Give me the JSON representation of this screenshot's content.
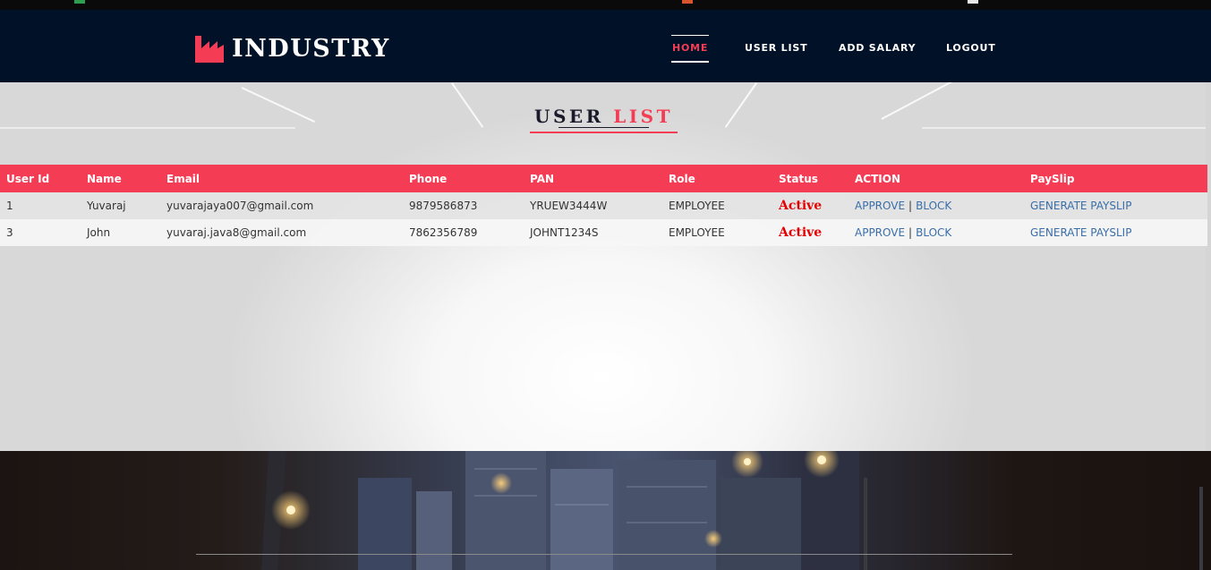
{
  "brand": {
    "name": "INDUSTRY",
    "icon": "factory-icon",
    "accent_color": "#f43d55"
  },
  "nav": {
    "items": [
      {
        "label": "HOME",
        "active": true
      },
      {
        "label": "USER LIST",
        "active": false
      },
      {
        "label": "ADD SALARY",
        "active": false
      },
      {
        "label": "LOGOUT",
        "active": false
      }
    ]
  },
  "page": {
    "title_part1": "USER",
    "title_part2": "LIST"
  },
  "table": {
    "headers": [
      "User Id",
      "Name",
      "Email",
      "Phone",
      "PAN",
      "Role",
      "Status",
      "ACTION",
      "PaySlip"
    ],
    "rows": [
      {
        "id": "1",
        "name": "Yuvaraj",
        "email": "yuvarajaya007@gmail.com",
        "phone": "9879586873",
        "pan": "YRUEW3444W",
        "role": "EMPLOYEE",
        "status": "Active",
        "approve": "APPROVE",
        "separator": "|",
        "block": "BLOCK",
        "payslip": "GENERATE PAYSLIP"
      },
      {
        "id": "3",
        "name": "John",
        "email": "yuvaraj.java8@gmail.com",
        "phone": "7862356789",
        "pan": "JOHNT1234S",
        "role": "EMPLOYEE",
        "status": "Active",
        "approve": "APPROVE",
        "separator": "|",
        "block": "BLOCK",
        "payslip": "GENERATE PAYSLIP"
      }
    ]
  },
  "colors": {
    "navbar_bg": "#011228",
    "header_row_bg": "#f43d55",
    "status_color": "#e60000",
    "link_color": "#3a6ea8"
  }
}
